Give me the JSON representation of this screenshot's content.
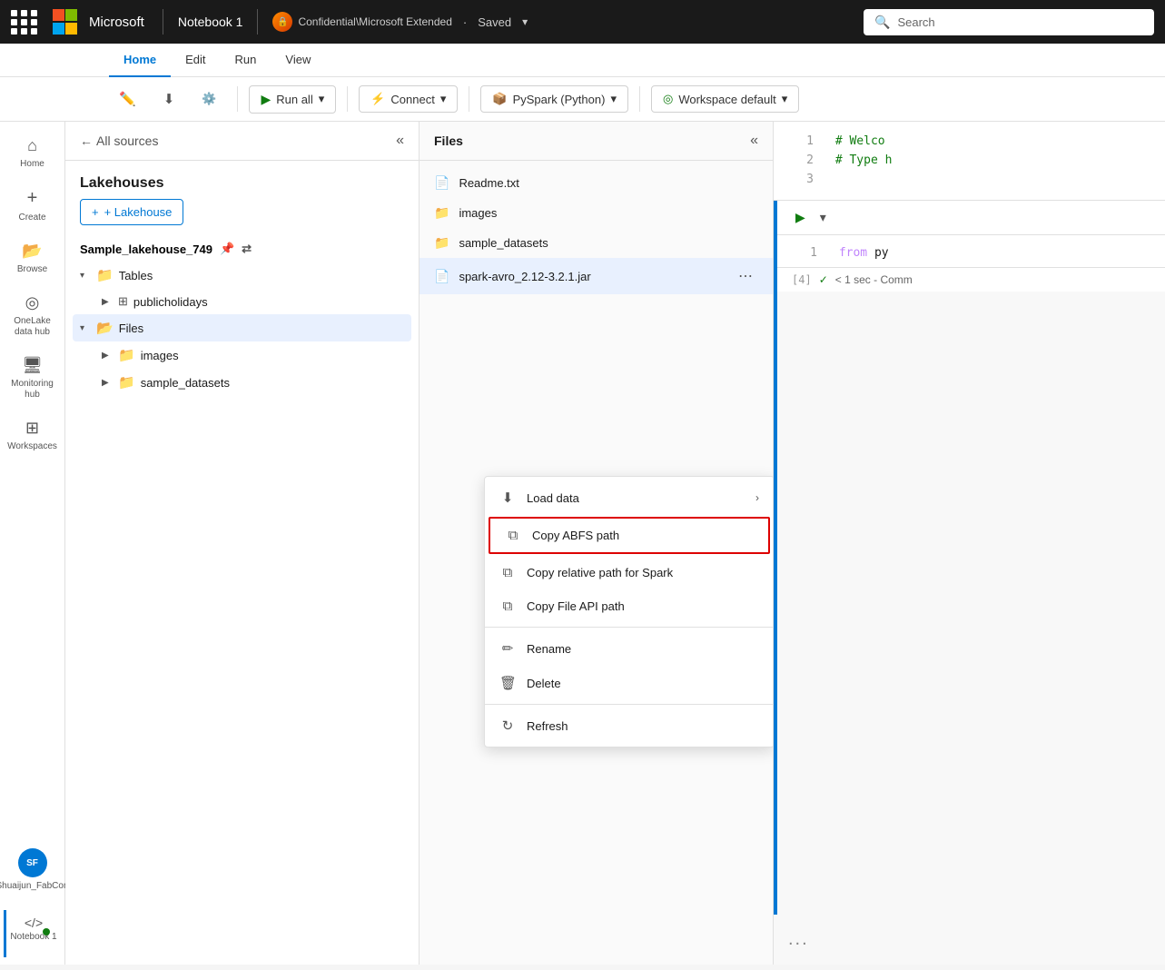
{
  "topbar": {
    "app_name": "Microsoft",
    "notebook_title": "Notebook 1",
    "badge_label": "Confidential\\Microsoft Extended",
    "status": "Saved",
    "search_placeholder": "Search"
  },
  "ribbon": {
    "tabs": [
      "Home",
      "Edit",
      "Run",
      "View"
    ],
    "active_tab": "Home",
    "buttons": {
      "run_all": "Run all",
      "connect": "Connect",
      "pyspark": "PySpark (Python)",
      "workspace": "Workspace default"
    }
  },
  "sidebar": {
    "items": [
      {
        "id": "home",
        "label": "Home",
        "icon": "⌂"
      },
      {
        "id": "create",
        "label": "Create",
        "icon": "+"
      },
      {
        "id": "browse",
        "label": "Browse",
        "icon": "📁"
      },
      {
        "id": "onelake",
        "label": "OneLake data hub",
        "icon": "◎"
      },
      {
        "id": "monitoring",
        "label": "Monitoring hub",
        "icon": "🖥"
      },
      {
        "id": "workspaces",
        "label": "Workspaces",
        "icon": "⊞"
      }
    ],
    "user": {
      "label": "Shuaijun_FabCon",
      "initials": "SF"
    },
    "notebook": {
      "label": "Notebook 1"
    }
  },
  "left_panel": {
    "back_label": "All sources",
    "title": "Lakehouses",
    "add_button": "+ Lakehouse",
    "lakehouse_name": "Sample_lakehouse_749",
    "tree": [
      {
        "id": "tables",
        "label": "Tables",
        "type": "folder",
        "expanded": true
      },
      {
        "id": "publicholidays",
        "label": "publicholidays",
        "type": "table",
        "indent": 1
      },
      {
        "id": "files",
        "label": "Files",
        "type": "folder-teal",
        "expanded": true,
        "selected": true
      },
      {
        "id": "images",
        "label": "images",
        "type": "folder",
        "indent": 1
      },
      {
        "id": "sample_datasets",
        "label": "sample_datasets",
        "type": "folder",
        "indent": 1
      }
    ]
  },
  "middle_panel": {
    "title": "Files",
    "files": [
      {
        "id": "readme",
        "name": "Readme.txt",
        "type": "file"
      },
      {
        "id": "images",
        "name": "images",
        "type": "folder"
      },
      {
        "id": "sample_datasets",
        "name": "sample_datasets",
        "type": "folder"
      },
      {
        "id": "spark_jar",
        "name": "spark-avro_2.12-3.2.1.jar",
        "type": "file",
        "selected": true,
        "has_more": true
      }
    ]
  },
  "context_menu": {
    "items": [
      {
        "id": "load_data",
        "label": "Load data",
        "icon": "⬇",
        "has_arrow": true
      },
      {
        "id": "copy_abfs",
        "label": "Copy ABFS path",
        "icon": "⧉",
        "highlighted": true
      },
      {
        "id": "copy_spark",
        "label": "Copy relative path for Spark",
        "icon": "⧉"
      },
      {
        "id": "copy_api",
        "label": "Copy File API path",
        "icon": "⧉"
      },
      {
        "id": "rename",
        "label": "Rename",
        "icon": "✏"
      },
      {
        "id": "delete",
        "label": "Delete",
        "icon": "🗑"
      },
      {
        "id": "refresh",
        "label": "Refresh",
        "icon": "↻"
      }
    ]
  },
  "code_panel": {
    "cell1": {
      "lines": [
        {
          "num": "1",
          "code": "# Welco",
          "type": "comment"
        },
        {
          "num": "2",
          "code": "# Type h",
          "type": "comment"
        },
        {
          "num": "3",
          "code": "",
          "type": "plain"
        }
      ]
    },
    "cell2": {
      "lines": [
        {
          "num": "1",
          "code": "from py",
          "type": "from"
        }
      ],
      "cell_number": "[4]",
      "status": "✓",
      "status_text": "< 1 sec - Comm"
    },
    "dots": "..."
  }
}
